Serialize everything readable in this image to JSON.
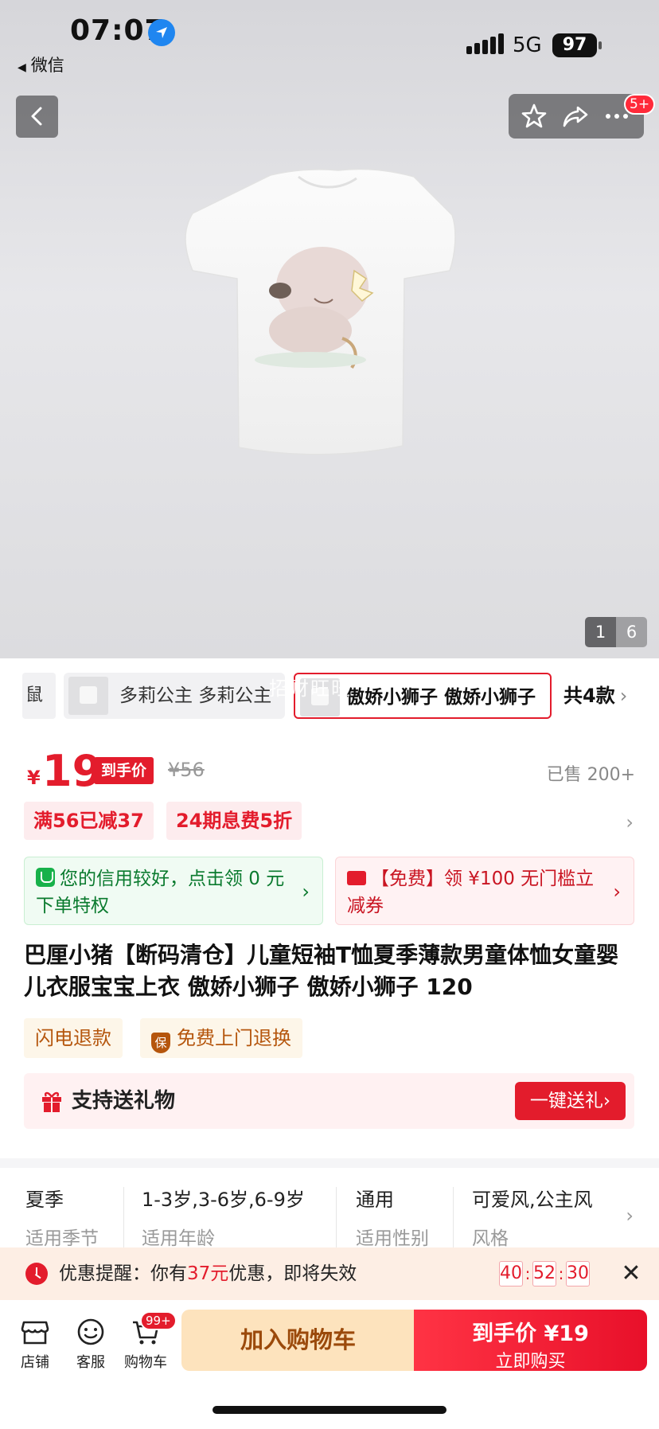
{
  "status_bar": {
    "time": "07:07",
    "back_app": "微信",
    "network": "5G",
    "battery": "97",
    "icons": [
      "location-arrow-icon",
      "signal-bars-icon",
      "battery-icon"
    ]
  },
  "nav": {
    "cart_badge": "5+",
    "icons": [
      "back-icon",
      "star-icon",
      "share-icon",
      "more-icon"
    ]
  },
  "gallery": {
    "current": "1",
    "total": "6"
  },
  "variants": {
    "partial_label": "鼠",
    "items": [
      {
        "label": "多莉公主 多莉公主",
        "selected": false
      },
      {
        "label": "傲娇小狮子 傲娇小狮子",
        "selected": true
      }
    ],
    "watermark": "招财旺旺",
    "count_label": "共4款",
    "chevron": "›"
  },
  "price": {
    "currency": "¥",
    "value": "19",
    "tag": "到手价",
    "original": "¥56",
    "sold": "已售 200+"
  },
  "promos": [
    "满56已减37",
    "24期息费5折"
  ],
  "benefits": {
    "credit": "您的信用较好，点击领 0 元下单特权",
    "coupon": "【免费】领 ¥100 无门槛立减券"
  },
  "product_title": "巴厘小猪【断码清仓】儿童短袖T恤夏季薄款男童体恤女童婴儿衣服宝宝上衣 傲娇小狮子 傲娇小狮子 120",
  "services": {
    "refund": "闪电退款",
    "shield_char": "保",
    "pickup": "免费上门退换"
  },
  "gift": {
    "label": "支持送礼物",
    "button": "一键送礼"
  },
  "attributes": [
    {
      "value": "夏季",
      "key": "适用季节"
    },
    {
      "value": "1-3岁,3-6岁,6-9岁",
      "key": "适用年龄"
    },
    {
      "value": "通用",
      "key": "适用性别"
    },
    {
      "value": "可爱风,公主风",
      "key": "风格"
    }
  ],
  "reminder": {
    "prefix": "优惠提醒：你有",
    "amount": "37元",
    "suffix": "优惠，即将失效",
    "hours": "40",
    "minutes": "52",
    "seconds": "30",
    "colon": ":",
    "close": "✕"
  },
  "bottom_bar": {
    "store": "店铺",
    "service": "客服",
    "cart": "购物车",
    "cart_badge": "99+",
    "add_to_cart": "加入购物车",
    "buy_line1": "到手价 ¥19",
    "buy_line2": "立即购买"
  },
  "colors": {
    "accent_red": "#e31c2c",
    "cart_button_bg": "#fde3bd",
    "credit_green": "#0a7a2e"
  }
}
